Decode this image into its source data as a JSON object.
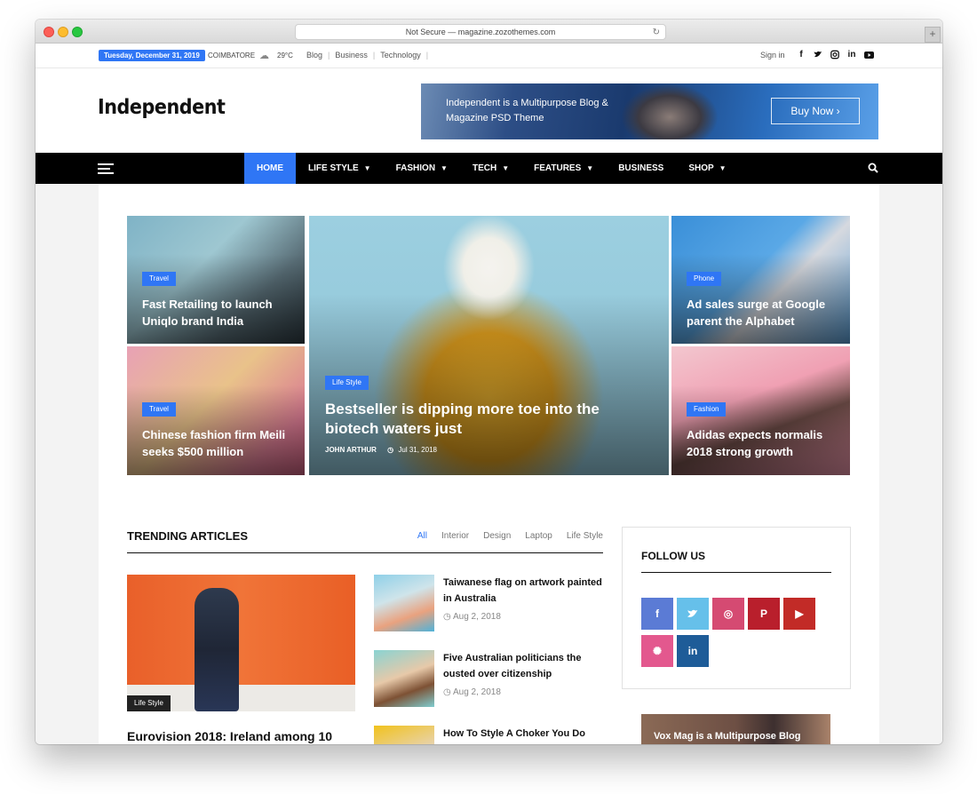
{
  "browser": {
    "url_text": "Not Secure — magazine.zozothemes.com",
    "reload_icon": "reload-icon",
    "new_tab_symbol": "+"
  },
  "topbar": {
    "date": "Tuesday, December 31, 2019",
    "city": "COIMBATORE",
    "weather_icon": "☁",
    "temperature": "29°C",
    "links": [
      "Blog",
      "Business",
      "Technology"
    ],
    "signin": "Sign in",
    "social": [
      "f",
      "t",
      "ig",
      "in",
      "yt"
    ]
  },
  "header": {
    "logo": "Independent",
    "banner": {
      "text": "Independent is a Multipurpose Blog & Magazine PSD Theme",
      "button": "Buy Now ›"
    }
  },
  "nav": {
    "items": [
      {
        "label": "HOME",
        "dropdown": false,
        "active": true
      },
      {
        "label": "LIFE STYLE",
        "dropdown": true
      },
      {
        "label": "FASHION",
        "dropdown": true
      },
      {
        "label": "TECH",
        "dropdown": true
      },
      {
        "label": "FEATURES",
        "dropdown": true
      },
      {
        "label": "BUSINESS",
        "dropdown": false
      },
      {
        "label": "SHOP",
        "dropdown": true
      }
    ]
  },
  "hero": {
    "tiles": [
      {
        "tag": "Travel",
        "title": "Fast Retailing to launch Uniqlo brand India"
      },
      {
        "tag": "Travel",
        "title": "Chinese fashion firm Meili seeks $500 million"
      },
      {
        "tag": "Life Style",
        "title": "Bestseller is dipping more toe into the biotech waters just",
        "author": "JOHN ARTHUR",
        "date": "Jul 31, 2018"
      },
      {
        "tag": "Phone",
        "title": "Ad sales surge at Google parent the Alphabet"
      },
      {
        "tag": "Fashion",
        "title": "Adidas expects normalis 2018 strong growth"
      }
    ]
  },
  "trending": {
    "title": "TRENDING ARTICLES",
    "filters": [
      "All",
      "Interior",
      "Design",
      "Laptop",
      "Life Style"
    ],
    "feature": {
      "tag": "Life Style",
      "title": "Eurovision 2018: Ireland among 10"
    },
    "articles": [
      {
        "title": "Taiwanese flag on artwork painted in Australia",
        "date": "Aug 2, 2018"
      },
      {
        "title": "Five Australian politicians the ousted over citizenship",
        "date": "Aug 2, 2018"
      },
      {
        "title": "How To Style A Choker You Do",
        "date": ""
      }
    ]
  },
  "follow": {
    "title": "FOLLOW US",
    "buttons": [
      {
        "name": "facebook",
        "glyph": "f",
        "color": "#5b7bd5"
      },
      {
        "name": "twitter",
        "glyph": "t",
        "color": "#66c0ea"
      },
      {
        "name": "instagram",
        "glyph": "◎",
        "color": "#d54a72"
      },
      {
        "name": "pinterest",
        "glyph": "P",
        "color": "#b91f2c"
      },
      {
        "name": "youtube",
        "glyph": "▶",
        "color": "#c22b27"
      },
      {
        "name": "dribbble",
        "glyph": "✺",
        "color": "#e3588e"
      },
      {
        "name": "linkedin",
        "glyph": "in",
        "color": "#1e5c98"
      }
    ]
  },
  "promo": {
    "text": "Vox Mag is a Multipurpose Blog"
  },
  "colors": {
    "accent": "#2f76f5",
    "nav": "#000000"
  }
}
